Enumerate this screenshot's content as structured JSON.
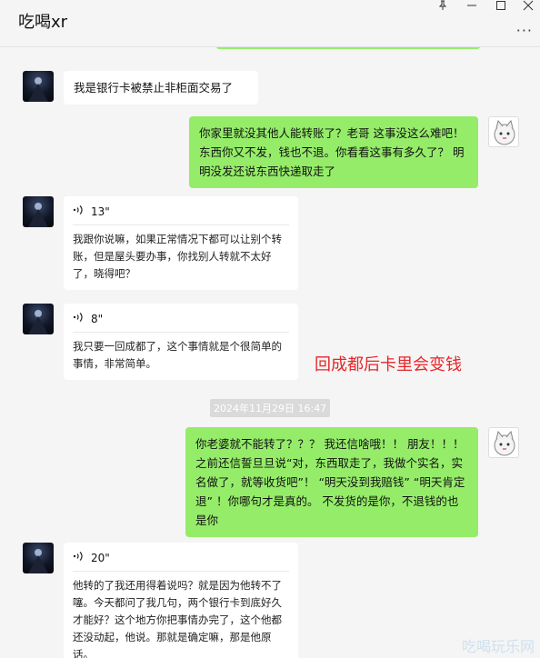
{
  "window": {
    "title": "吃喝xr",
    "more": "···"
  },
  "messages": [
    {
      "text": "我是银行卡被禁止非柜面交易了"
    },
    {
      "text": "你家里就没其他人能转账了？老哥 这事没这么难吧！ 东西你又不发，钱也不退。你看看这事有多久了？ 明明没发还说东西快递取走了"
    },
    {
      "duration": "13\"",
      "transcript": "我跟你说嘛，如果正常情况下都可以让别个转账，但是屋头要办事，你找别人转就不太好了，晓得吧？"
    },
    {
      "duration": "8\"",
      "transcript": "我只要一回成都了，这个事情就是个很简单的事情，非常简单。"
    },
    {
      "text": "你老婆就不能转了？？？ 我还信啥哦！！ 朋友！！！ 之前还信誓旦旦说“对，东西取走了，我做个实名，实名做了，就等收货吧”！ “明天没到我赔钱” “明天肯定退” ！你哪句才是真的。 不发货的是你，不退钱的也是你"
    },
    {
      "duration": "20\"",
      "transcript": "他转的了我还用得着说吗？就是因为他转不了噻。今天都问了我几句，两个银行卡到底好久才能好？这个地方你把事情办完了，这个他都还没动起，他说。那就是确定嘛，那是他原话。"
    }
  ],
  "timestamp": "2024年11月29日 16:47",
  "annotation": "回成都后卡里会变钱",
  "watermark": "吃喝玩乐网",
  "icons": {
    "pin": "pin-icon",
    "minimize": "minimize-icon",
    "maximize": "maximize-icon",
    "close": "close-icon",
    "voice": "voice-wave-icon"
  },
  "colors": {
    "green_bubble": "#95ec69",
    "white_bubble": "#ffffff",
    "background": "#f5f5f5",
    "annotation": "#e6262a"
  }
}
